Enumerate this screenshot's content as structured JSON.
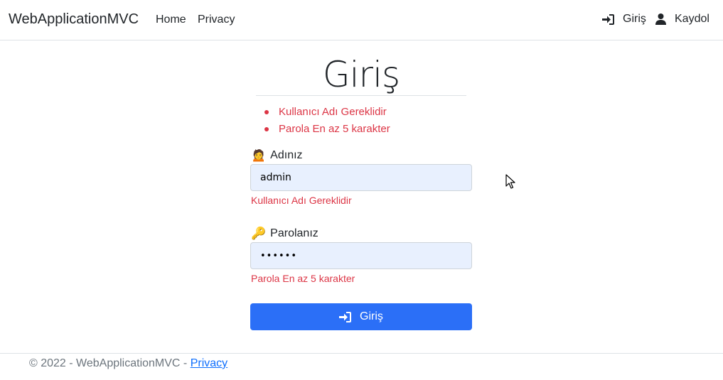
{
  "nav": {
    "brand": "WebApplicationMVC",
    "home": "Home",
    "privacy": "Privacy",
    "login": "Giriş",
    "register": "Kaydol",
    "login_icon": "sign-in-icon",
    "register_icon": "user-icon"
  },
  "page": {
    "title": "Giriş"
  },
  "validation_summary": [
    "Kullanıcı Adı Gereklidir",
    "Parola En az 5 karakter"
  ],
  "form": {
    "username_emoji": "🙍",
    "username_label": "Adınız",
    "username_value": "admin",
    "username_error": "Kullanıcı Adı Gereklidir",
    "password_emoji": "🔑",
    "password_label": "Parolanız",
    "password_value": "••••••",
    "password_error": "Parola En az 5 karakter",
    "submit_label": "Giriş"
  },
  "footer": {
    "text": "© 2022 - WebApplicationMVC - ",
    "privacy_link": "Privacy"
  },
  "colors": {
    "primary": "#2b6ff7",
    "danger": "#dc3545",
    "input_bg": "#e8f0fe"
  }
}
